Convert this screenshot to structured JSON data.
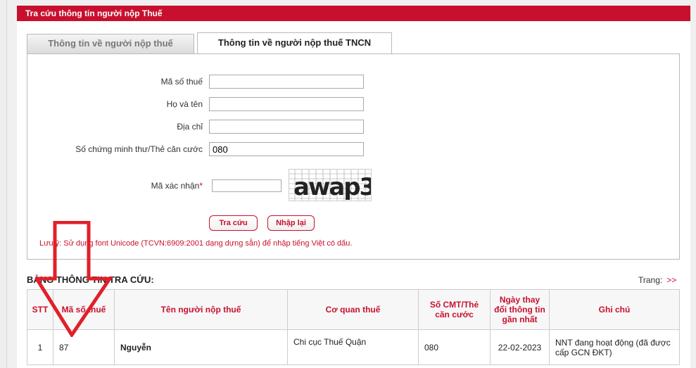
{
  "page": {
    "title": "Tra cứu thông tin người nộp Thuế"
  },
  "tabs": [
    {
      "label": "Thông tin về người nộp thuế",
      "active": false
    },
    {
      "label": "Thông tin về người nộp thuế TNCN",
      "active": true
    }
  ],
  "form": {
    "tax_code": {
      "label": "Mã số thuế",
      "value": ""
    },
    "full_name": {
      "label": "Họ và tên",
      "value": ""
    },
    "address": {
      "label": "Địa chỉ",
      "value": ""
    },
    "id_number": {
      "label": "Số chứng minh thư/Thẻ căn cước",
      "value": "080"
    },
    "captcha": {
      "label": "Mã xác nhận",
      "required_mark": "*",
      "value": "",
      "image_text": "awap3"
    }
  },
  "buttons": {
    "search": "Tra cứu",
    "reset": "Nhập lại"
  },
  "note": "Lưu ý: Sử dụng font Unicode (TCVN:6909:2001 dạng dựng sẵn) để nhập tiếng Việt có dấu.",
  "results": {
    "title": "BẢNG THÔNG TIN TRA CỨU:",
    "pager_label": "Trang:",
    "pager_next": ">>",
    "columns": [
      "STT",
      "Mã số thuế",
      "Tên người nộp thuế",
      "Cơ quan thuế",
      "Số CMT/Thẻ căn cước",
      "Ngày thay đổi thông tin gần nhất",
      "Ghi chú"
    ],
    "rows": [
      {
        "stt": "1",
        "tax_code": "87",
        "name": "Nguyễn",
        "tax_office": "Chi cục Thuế Quận",
        "id_number": "080",
        "changed_date": "22-02-2023",
        "note": "NNT đang hoạt động (đã được cấp GCN ĐKT)"
      }
    ]
  },
  "colors": {
    "accent": "#c8102e",
    "arrow": "#e0202a"
  }
}
